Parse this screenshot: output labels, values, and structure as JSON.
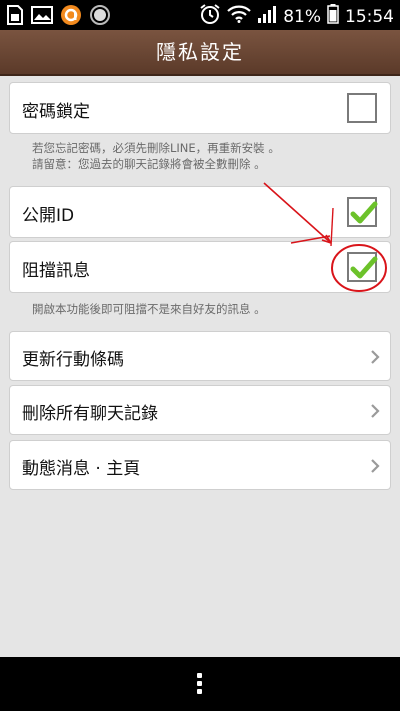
{
  "status": {
    "battery": "81%",
    "time": "15:54"
  },
  "header": {
    "title": "隱私設定"
  },
  "passcode": {
    "label": "密碼鎖定",
    "checked": false,
    "note_line1": "若您忘記密碼，必須先刪除LINE，再重新安裝 。",
    "note_line2": "請留意：您過去的聊天記錄將會被全數刪除 。"
  },
  "public_id": {
    "label": "公開ID",
    "checked": true
  },
  "block_messages": {
    "label": "阻擋訊息",
    "checked": true,
    "note": "開啟本功能後即可阻擋不是來自好友的訊息 。"
  },
  "menu": {
    "items": [
      {
        "label": "更新行動條碼"
      },
      {
        "label": "刪除所有聊天記錄"
      },
      {
        "label": "動態消息 · 主頁"
      }
    ]
  },
  "colors": {
    "accent_brown": "#6b4633",
    "check_green": "#6cc22a",
    "annotation_red": "#d9141a"
  }
}
